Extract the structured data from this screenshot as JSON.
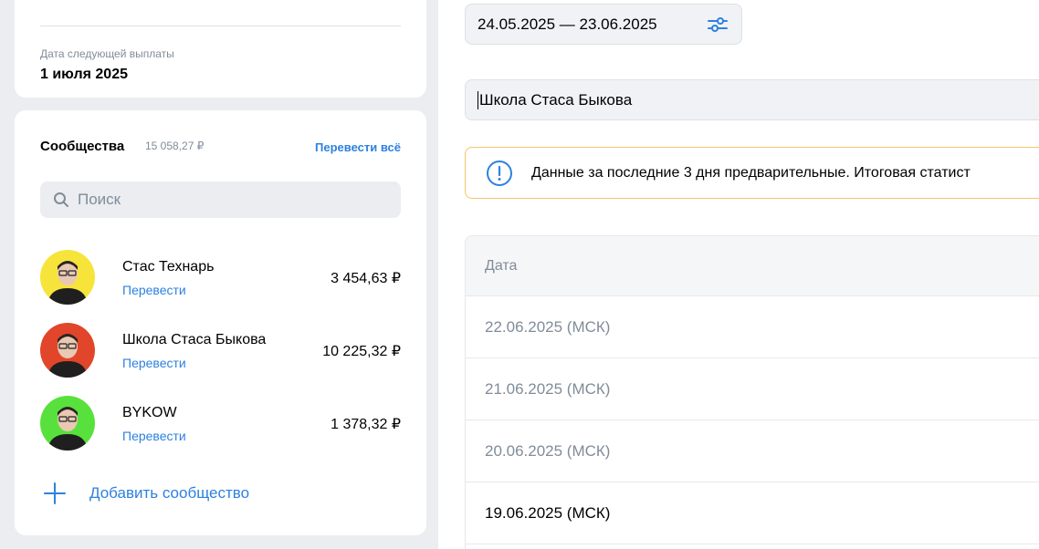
{
  "payout": {
    "label": "Дата следующей выплаты",
    "value": "1 июля 2025"
  },
  "communities": {
    "title": "Сообщества",
    "total": "15 058,27 ₽",
    "transfer_all": "Перевести всё",
    "search_placeholder": "Поиск",
    "items": [
      {
        "name": "Стас Технарь",
        "action": "Перевести",
        "amount": "3 454,63 ₽",
        "avatar_color": "#f7e43b"
      },
      {
        "name": "Школа Стаса Быкова",
        "action": "Перевести",
        "amount": "10 225,32 ₽",
        "avatar_color": "#e2462a"
      },
      {
        "name": "BYKOW",
        "action": "Перевести",
        "amount": "1 378,32 ₽",
        "avatar_color": "#58e13c"
      }
    ],
    "add_label": "Добавить сообщество"
  },
  "filters": {
    "date_range": "24.05.2025 — 23.06.2025",
    "community": "Школа Стаса Быкова"
  },
  "notice": {
    "text": "Данные за последние 3 дня предварительные. Итоговая статист"
  },
  "table": {
    "header": "Дата",
    "rows": [
      {
        "date": "22.06.2025 (МСК)",
        "state": "preliminary"
      },
      {
        "date": "21.06.2025 (МСК)",
        "state": "preliminary"
      },
      {
        "date": "20.06.2025 (МСК)",
        "state": "preliminary"
      },
      {
        "date": "19.06.2025 (МСК)",
        "state": "final"
      }
    ]
  },
  "colors": {
    "accent": "#2d81e0",
    "notice_border": "#f5c56b",
    "muted_text": "#818c99"
  }
}
